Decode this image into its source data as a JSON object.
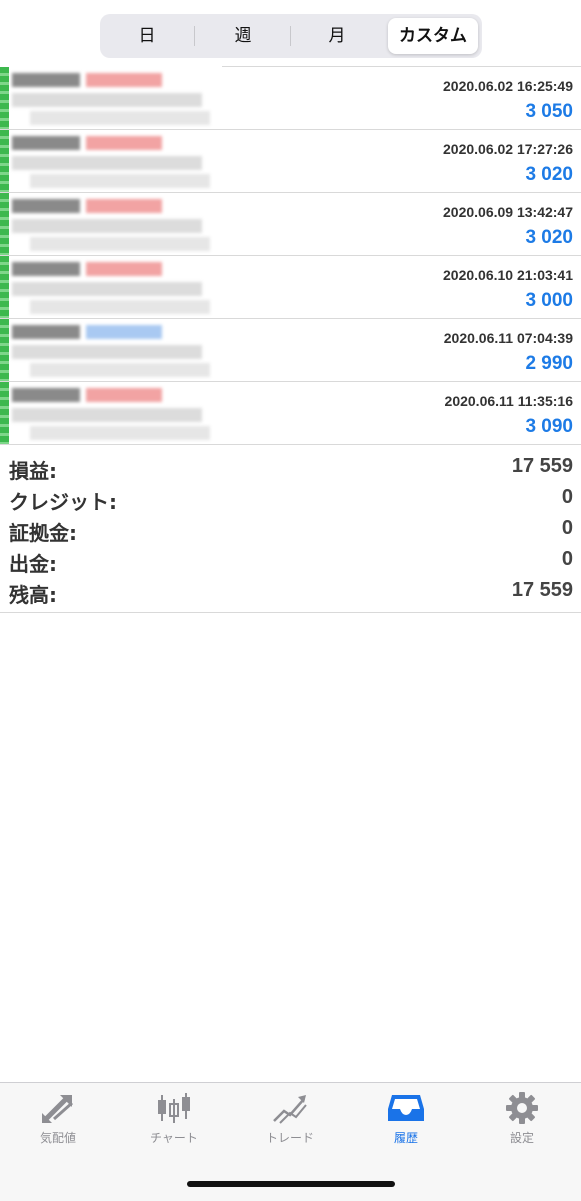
{
  "segments": [
    "日",
    "週",
    "月",
    "カスタム"
  ],
  "selected_segment": "カスタム",
  "history": [
    {
      "date": "2020.06.02 16:25:49",
      "value": "3 050",
      "color": "red"
    },
    {
      "date": "2020.06.02 17:27:26",
      "value": "3 020",
      "color": "red"
    },
    {
      "date": "2020.06.09 13:42:47",
      "value": "3 020",
      "color": "red"
    },
    {
      "date": "2020.06.10 21:03:41",
      "value": "3 000",
      "color": "red"
    },
    {
      "date": "2020.06.11 07:04:39",
      "value": "2 990",
      "color": "blue"
    },
    {
      "date": "2020.06.11 11:35:16",
      "value": "3 090",
      "color": "red"
    }
  ],
  "summary": [
    {
      "label": "損益:",
      "value": "17 559"
    },
    {
      "label": "クレジット:",
      "value": "0"
    },
    {
      "label": "証拠金:",
      "value": "0"
    },
    {
      "label": "出金:",
      "value": "0"
    },
    {
      "label": "残高:",
      "value": "17 559"
    }
  ],
  "tabs": [
    {
      "label": "気配値",
      "icon": "quotes-arrows-icon"
    },
    {
      "label": "チャート",
      "icon": "candlestick-chart-icon"
    },
    {
      "label": "トレード",
      "icon": "trade-trend-icon"
    },
    {
      "label": "履歴",
      "icon": "history-inbox-icon",
      "active": true
    },
    {
      "label": "設定",
      "icon": "settings-gear-icon"
    }
  ],
  "colors": {
    "accent": "#1a73e8",
    "value_blue": "#1d7be6",
    "green": "#3db84e"
  }
}
